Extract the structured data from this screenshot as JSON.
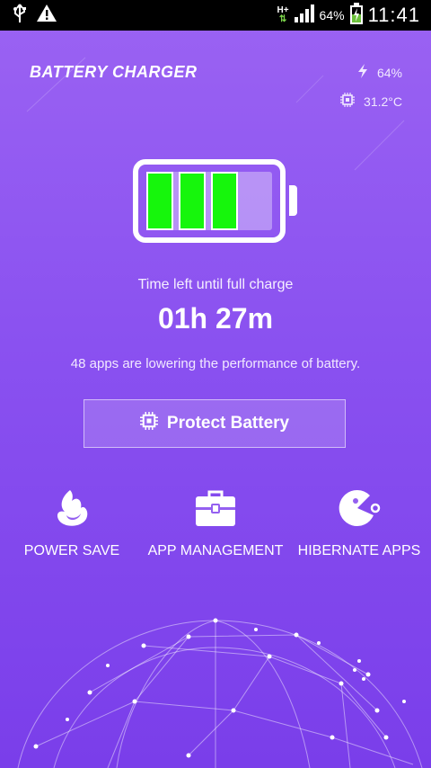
{
  "status_bar": {
    "network": "H+",
    "battery_percent": "64%",
    "time": "11:41",
    "icons": [
      "usb-icon",
      "warning-icon",
      "network-arrows-icon",
      "signal-icon",
      "battery-charging-icon"
    ]
  },
  "header": {
    "title": "BATTERY CHARGER",
    "charge_level": "64%",
    "temperature": "31.2°C",
    "icons": [
      "bolt-icon",
      "chip-icon"
    ]
  },
  "battery": {
    "filled_cells": 3,
    "total_cells": 4,
    "cell_color": "#16f60c"
  },
  "charge_info": {
    "subtitle": "Time left until full charge",
    "time_left": "01h 27m",
    "apps_message": "48 apps are lowering the performance of battery."
  },
  "protect_button": {
    "label": "Protect Battery",
    "icon": "chip-icon"
  },
  "features": [
    {
      "label": "POWER SAVE",
      "icon": "flame-icon"
    },
    {
      "label": "APP MANAGEMENT",
      "icon": "toolbox-icon"
    },
    {
      "label": "HIBERNATE APPS",
      "icon": "pacman-icon"
    }
  ],
  "colors": {
    "background_top": "#9b63f3",
    "background_bottom": "#7a3eea",
    "accent_green": "#16f60c"
  }
}
